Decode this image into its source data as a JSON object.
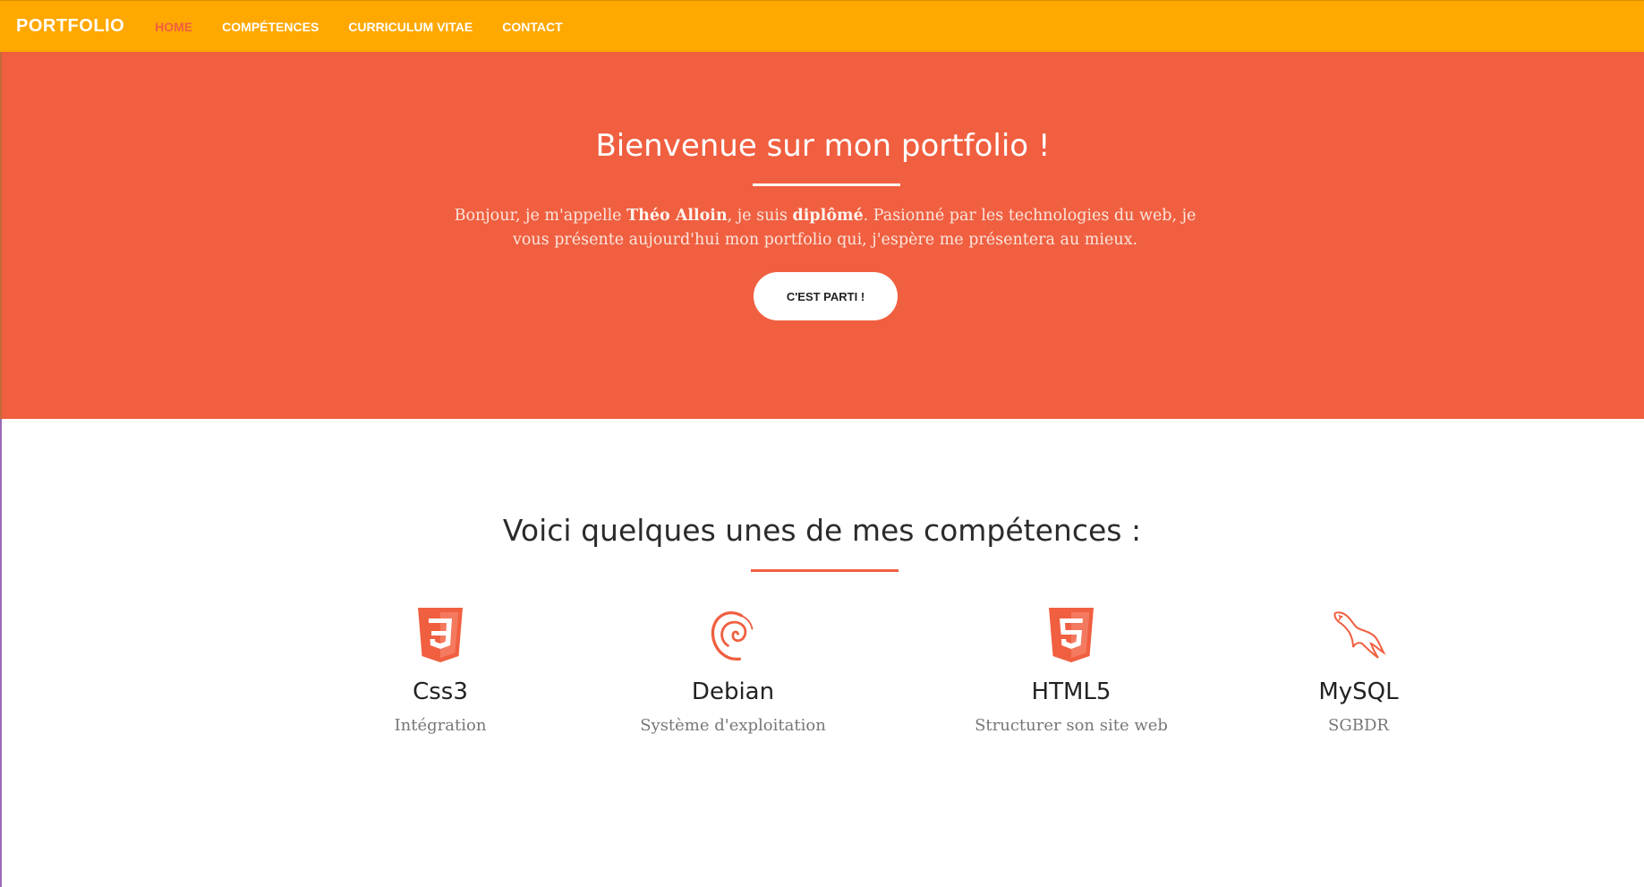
{
  "navbar": {
    "brand": "PORTFOLIO",
    "links": [
      {
        "label": "HOME",
        "active": true
      },
      {
        "label": "COMPÉTENCES",
        "active": false
      },
      {
        "label": "CURRICULUM VITAE",
        "active": false
      },
      {
        "label": "CONTACT",
        "active": false
      }
    ]
  },
  "hero": {
    "title": "Bienvenue sur mon portfolio !",
    "text_before_name": "Bonjour, je m'appelle ",
    "name": "Théo Alloin",
    "text_mid": ", je suis ",
    "status": "diplômé",
    "text_after": ". Pasionné par les technologies du web, je vous présente aujourd'hui mon portfolio qui, j'espère me présentera au mieux.",
    "button_label": "C'EST PARTI !"
  },
  "skills": {
    "title": "Voici quelques unes de mes compétences :",
    "items": [
      {
        "icon": "css3-icon",
        "name": "Css3",
        "description": "Intégration"
      },
      {
        "icon": "debian-icon",
        "name": "Debian",
        "description": "Système d'exploitation"
      },
      {
        "icon": "html5-icon",
        "name": "HTML5",
        "description": "Structurer son site web"
      },
      {
        "icon": "mysql-icon",
        "name": "MySQL",
        "description": "SGBDR"
      }
    ]
  },
  "colors": {
    "navbar": "#ffa800",
    "accent": "#f05f40",
    "white": "#ffffff"
  }
}
